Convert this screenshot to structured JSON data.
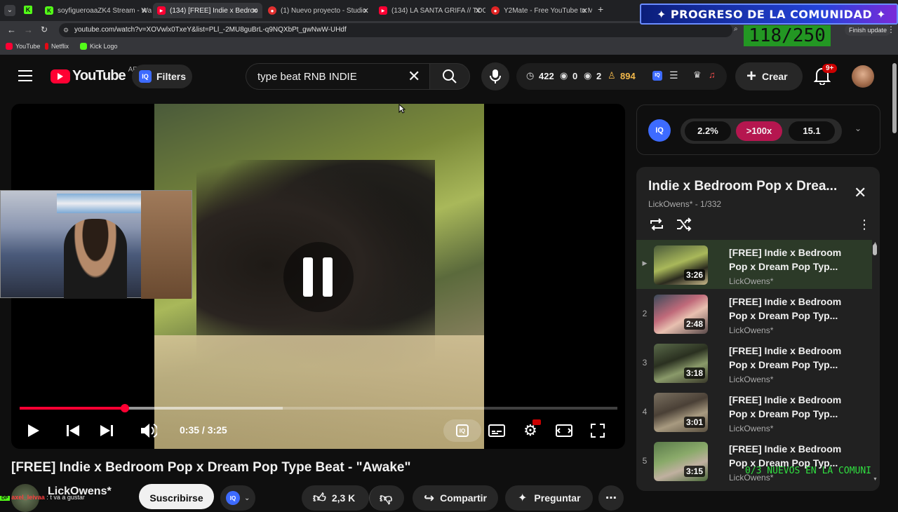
{
  "browser": {
    "tabs": [
      {
        "label": "soyfigueroaaZK4 Stream - Watc",
        "fav_color": "#53fc18",
        "fav_char": "K"
      },
      {
        "label": "(134) [FREE] Indie x Bedroo",
        "fav_color": "#ff0033",
        "fav_char": "▶"
      },
      {
        "label": "(1) Nuevo proyecto - Studio",
        "fav_color": "#e03030",
        "fav_char": "●"
      },
      {
        "label": "(134) LA SANTA GRIFA // TOCAR",
        "fav_color": "#ff0033",
        "fav_char": "▶"
      },
      {
        "label": "Y2Mate - Free YouTube to MP3",
        "fav_color": "#e02424",
        "fav_char": "●"
      }
    ],
    "new_tab": "+",
    "url": "youtube.com/watch?v=XOVwlx0TxeY&list=PLl_-2MU8guBrL-q9NQXbPt_gwNwW-UHdf",
    "finish_update": "Finish update",
    "bookmarks": [
      {
        "label": "YouTube",
        "fav_color": "#ff0033"
      },
      {
        "label": "Netflix",
        "fav_color": "#e50914"
      },
      {
        "label": "Kick Logo",
        "fav_color": "#53fc18"
      }
    ]
  },
  "overlay": {
    "community_title": "PROGRESO DE LA COMUNIDAD",
    "counter": "118/250",
    "nuevos": "0/3 NUEVOS EN LA COMUNI",
    "chat_user": "axel_leivaa",
    "chat_text": ": t va a gustar"
  },
  "header": {
    "logo_text": "YouTube",
    "country": "AR",
    "filters_label": "Filters",
    "search_value": "type beat RNB INDIE",
    "stats": {
      "time": "422",
      "views": "0",
      "watching": "2",
      "users": "894"
    },
    "create_label": "Crear",
    "notif_badge": "9+"
  },
  "player": {
    "current_time": "0:35",
    "duration": "3:25",
    "time_display": "0:35 / 3:25",
    "progress_fraction": 0.176,
    "buffered_fraction": 0.44
  },
  "iq_panel": {
    "stats": [
      "2.2%",
      ">100x",
      "15.1"
    ]
  },
  "playlist": {
    "title": "Indie x Bedroom Pop x Drea...",
    "subtitle": "LickOwens* - 1/332",
    "items": [
      {
        "index": "▶",
        "title_line1": "[FREE] Indie x Bedroom",
        "title_line2": "Pop x Dream Pop Typ...",
        "channel": "LickOwens*",
        "duration": "3:26",
        "current": true
      },
      {
        "index": "2",
        "title_line1": "[FREE] Indie x Bedroom",
        "title_line2": "Pop x Dream Pop Typ...",
        "channel": "LickOwens*",
        "duration": "2:48",
        "current": false
      },
      {
        "index": "3",
        "title_line1": "[FREE] Indie x Bedroom",
        "title_line2": "Pop x Dream Pop Typ...",
        "channel": "LickOwens*",
        "duration": "3:18",
        "current": false
      },
      {
        "index": "4",
        "title_line1": "[FREE] Indie x Bedroom",
        "title_line2": "Pop x Dream Pop Typ...",
        "channel": "LickOwens*",
        "duration": "3:01",
        "current": false
      },
      {
        "index": "5",
        "title_line1": "[FREE] Indie x Bedroom",
        "title_line2": "Pop x Dream Pop Typ...",
        "channel": "LickOwens*",
        "duration": "3:15",
        "current": false
      }
    ]
  },
  "video": {
    "title": "[FREE] Indie x Bedroom Pop x Dream Pop Type Beat - \"Awake\"",
    "channel": "LickOwens*",
    "subscribe_label": "Suscribirse",
    "likes": "2,3 K",
    "share_label": "Compartir",
    "ask_label": "Preguntar"
  },
  "colors": {
    "accent_red": "#ff0033",
    "iq_blue": "#3d6bff",
    "iq_pink": "#b5164f",
    "users_gold": "#f2b84b"
  }
}
